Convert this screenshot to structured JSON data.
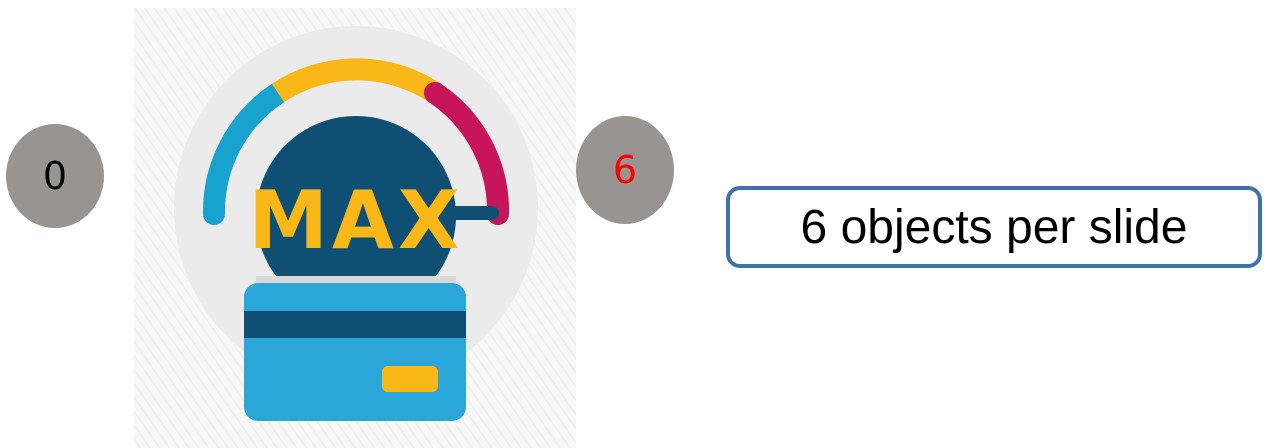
{
  "scale": {
    "min_label": "0",
    "max_label": "6"
  },
  "illustration": {
    "gauge_text": "MAX",
    "icon": "max-limit-gauge-card-icon"
  },
  "caption": "6 objects per slide",
  "colors": {
    "badge_bg": "#979491",
    "max_label_color": "#ff0000",
    "box_border": "#3f72a8",
    "gauge_blue": "#18a3cf",
    "gauge_yellow": "#f9b718",
    "gauge_red": "#c7145b",
    "gauge_navy": "#0f4f73",
    "card_blue": "#2aa7d8"
  }
}
